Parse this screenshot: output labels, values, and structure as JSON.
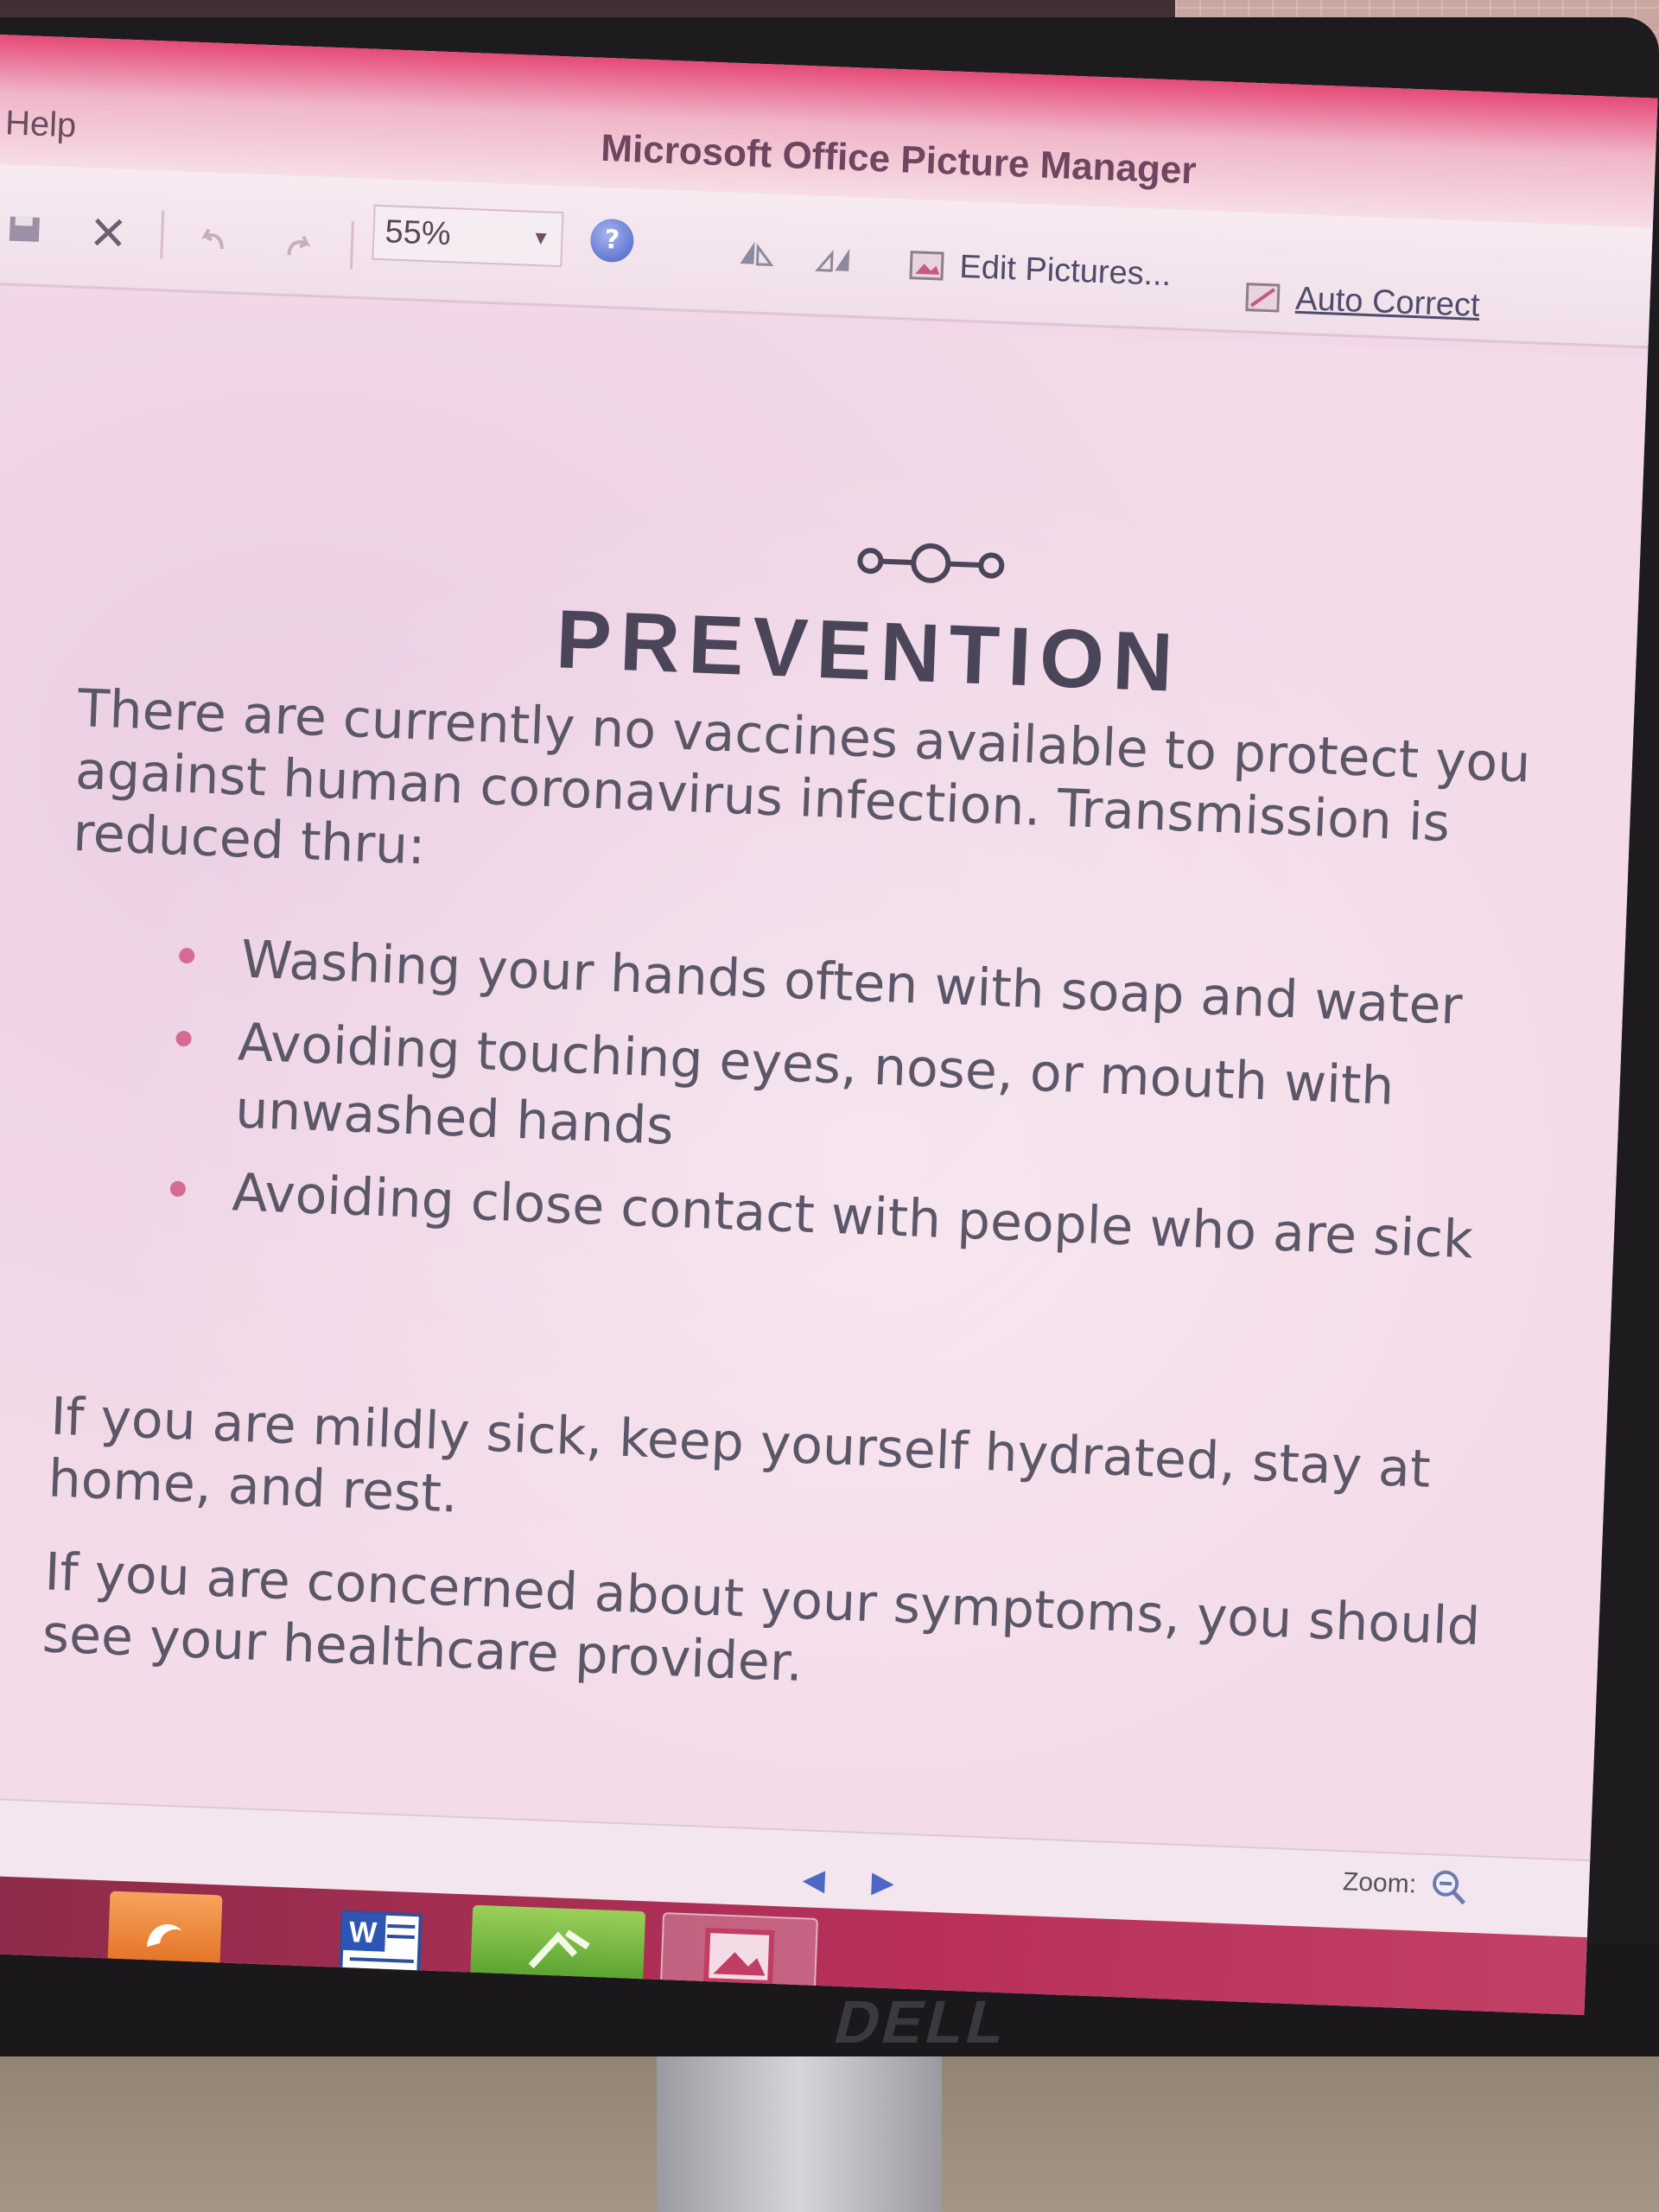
{
  "window": {
    "title": "Microsoft Office Picture Manager",
    "menu": {
      "help_label": "Help"
    }
  },
  "toolbar": {
    "zoom_value": "55%",
    "edit_pictures_label": "Edit Pictures...",
    "auto_correct_label": "Auto Correct",
    "icons": [
      "save-icon",
      "delete-icon",
      "undo-icon",
      "redo-icon",
      "help-icon",
      "rotate-left-icon",
      "rotate-right-icon",
      "edit-pictures-icon",
      "auto-correct-icon"
    ]
  },
  "slide": {
    "title": "PREVENTION",
    "intro": "There are currently no vaccines available to protect you against human coronavirus infection. Transmission is reduced thru:",
    "bullets": [
      "Washing your hands often with soap and water",
      "Avoiding touching eyes, nose, or mouth with unwashed hands",
      "Avoiding close contact with people who are sick"
    ],
    "paragraph_2": "If you are mildly sick, keep yourself hydrated, stay at home, and rest.",
    "paragraph_3": "If you are concerned about your symptoms, you should see your healthcare provider.",
    "accent_color": "#d76a93"
  },
  "status_bar": {
    "zoom_label": "Zoom:"
  },
  "taskbar": {
    "items": [
      "vlc-icon",
      "uc-browser-icon",
      "word-icon",
      "app-icon",
      "picture-manager-icon"
    ]
  },
  "monitor": {
    "brand": "DELL"
  }
}
